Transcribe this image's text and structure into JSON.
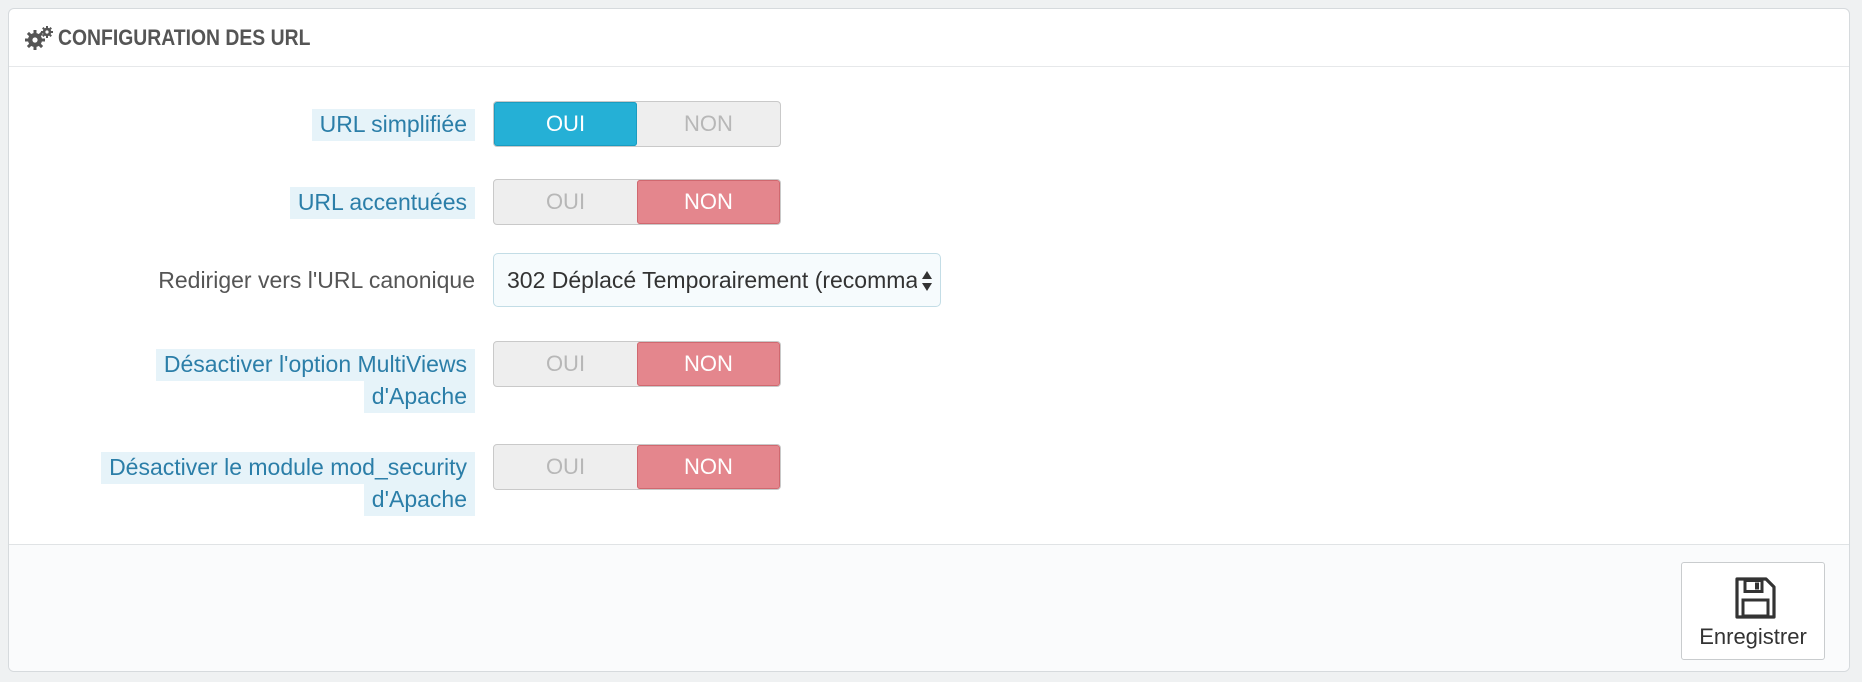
{
  "panel": {
    "title": "CONFIGURATION DES URL",
    "title_icon": "gears-icon"
  },
  "fields": {
    "simplified_url": {
      "label": "URL simplifiée",
      "yes": "OUI",
      "no": "NON",
      "value": "OUI"
    },
    "accented_url": {
      "label": "URL accentuées",
      "yes": "OUI",
      "no": "NON",
      "value": "NON"
    },
    "canonical_redirect": {
      "label": "Rediriger vers l'URL canonique",
      "selected": "302 Déplacé Temporairement (recomma"
    },
    "multiviews": {
      "label_line1": "Désactiver l'option MultiViews",
      "label_line2": "d'Apache",
      "yes": "OUI",
      "no": "NON",
      "value": "NON"
    },
    "mod_security": {
      "label_line1": "Désactiver le module mod_security",
      "label_line2": "d'Apache",
      "yes": "OUI",
      "no": "NON",
      "value": "NON"
    }
  },
  "footer": {
    "save_label": "Enregistrer",
    "save_icon": "floppy-disk-icon"
  },
  "colors": {
    "active_yes": "#25b0d6",
    "active_no": "#e4868d",
    "label_link": "#2b7ea8",
    "label_highlight": "#e6f3f9"
  }
}
